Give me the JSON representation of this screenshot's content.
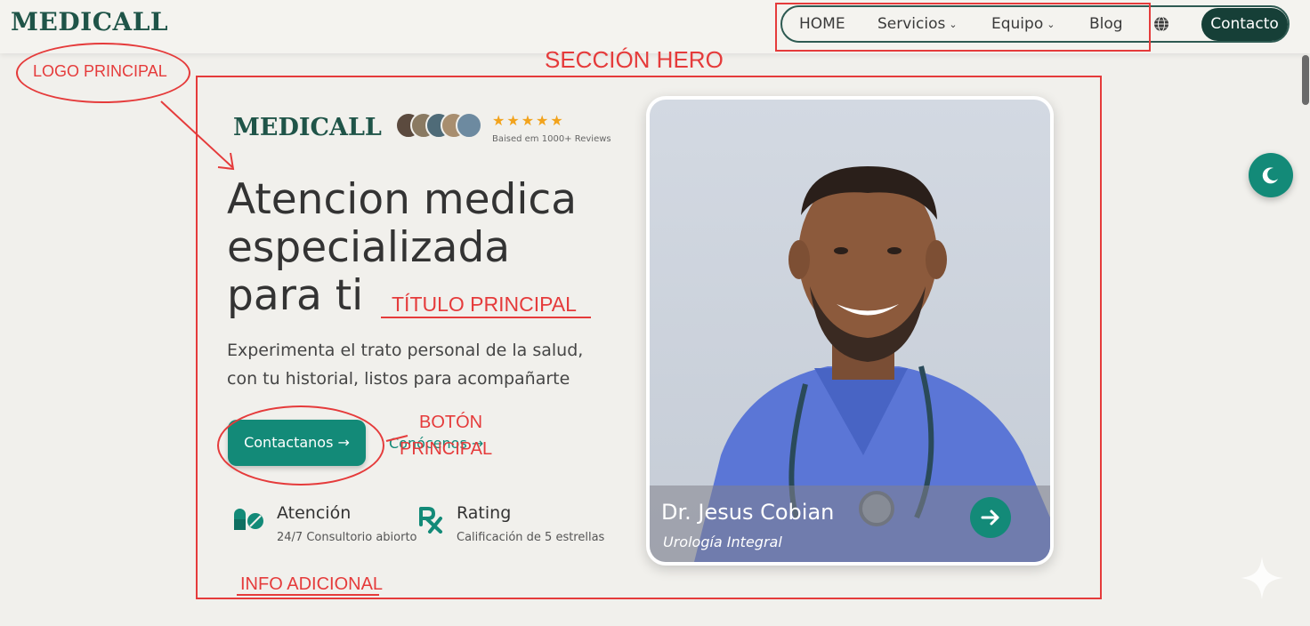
{
  "header": {
    "logo": "MEDICALL",
    "nav": [
      {
        "label": "HOME",
        "has_dropdown": false
      },
      {
        "label": "Servicios",
        "has_dropdown": true
      },
      {
        "label": "Equipo",
        "has_dropdown": true
      },
      {
        "label": "Blog",
        "has_dropdown": false
      }
    ],
    "language_icon": "globe-icon",
    "contact_label": "Contacto"
  },
  "hero": {
    "logo": "MEDICALL",
    "rating_stars": 5,
    "reviews_text": "Baised em 1000+ Reviews",
    "title_lines": [
      "Atencion medica",
      "especializada",
      "para ti"
    ],
    "subtitle_lines": [
      "Experimenta el trato personal de la salud,",
      "con tu historial, listos para acompañarte"
    ],
    "primary_button": "Contactanos →",
    "secondary_link": "Conócenos →",
    "features": [
      {
        "icon": "pills-icon",
        "title": "Atención",
        "subtitle": "24/7 Consultorio abiorto"
      },
      {
        "icon": "rx-icon",
        "title": "Rating",
        "subtitle": "Calificación de 5 estrellas"
      }
    ],
    "doctor": {
      "name": "Dr. Jesus Cobian",
      "specialty": "Urología Integral"
    }
  },
  "annotations": {
    "logo_principal": "LOGO PRINCIPAL",
    "seccion_hero": "SECCIÓN HERO",
    "titulo_principal": "TÍTULO PRINCIPAL",
    "boton_principal_line1": "BOTÓN",
    "boton_principal_line2": "PRINCIPAL",
    "info_adicional": "INFO ADICIONAL"
  },
  "colors": {
    "brand_green": "#1f5448",
    "accent_teal": "#138a78",
    "annotation_red": "#e53b3b",
    "star_gold": "#f2a31c"
  },
  "floating": {
    "theme_toggle_icon": "moon-icon",
    "sparkle_icon": "sparkle-icon"
  }
}
